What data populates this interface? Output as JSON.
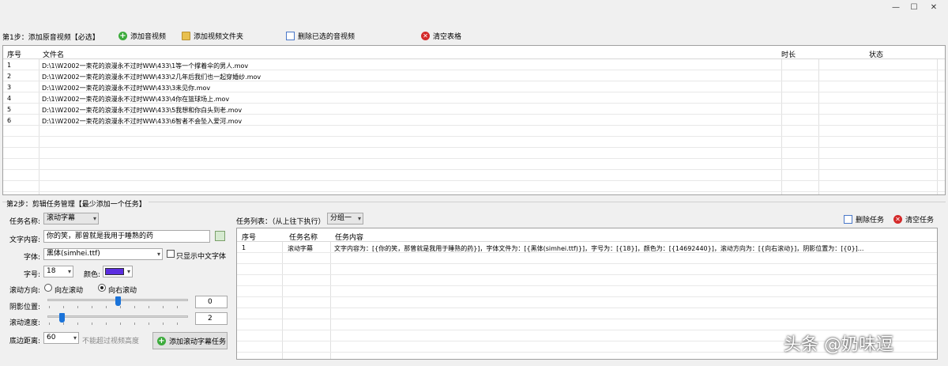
{
  "window": {
    "minimize": "—",
    "maximize": "☐",
    "close": "✕"
  },
  "step1": {
    "label": "第1步：添加原音视频【必选】",
    "add_video": "添加音视频",
    "add_folder": "添加视频文件夹",
    "delete_selected": "删除已选的音视频",
    "clear_table": "清空表格",
    "columns": [
      "序号",
      "文件名",
      "时长",
      "状态"
    ],
    "rows": [
      {
        "index": "1",
        "filename": "D:\\1\\W2002一束花的浪漫永不过时WW\\433\\1等一个撑着伞的男人.mov",
        "duration": "",
        "status": ""
      },
      {
        "index": "2",
        "filename": "D:\\1\\W2002一束花的浪漫永不过时WW\\433\\2几年后我们也一起穿婚纱.mov",
        "duration": "",
        "status": ""
      },
      {
        "index": "3",
        "filename": "D:\\1\\W2002一束花的浪漫永不过时WW\\433\\3未见你.mov",
        "duration": "",
        "status": ""
      },
      {
        "index": "4",
        "filename": "D:\\1\\W2002一束花的浪漫永不过时WW\\433\\4你在篮球场上.mov",
        "duration": "",
        "status": ""
      },
      {
        "index": "5",
        "filename": "D:\\1\\W2002一束花的浪漫永不过时WW\\433\\5我想和你白头到老.mov",
        "duration": "",
        "status": ""
      },
      {
        "index": "6",
        "filename": "D:\\1\\W2002一束花的浪漫永不过时WW\\433\\6智者不会坠入爱河.mov",
        "duration": "",
        "status": ""
      }
    ]
  },
  "step2": {
    "label": "第2步：剪辑任务管理【最少添加一个任务】",
    "task_name_label": "任务名称:",
    "task_name_value": "滚动字幕",
    "text_content_label": "文字内容:",
    "text_content_value": "你的笑，那曾就是我用于睡熟的药",
    "font_label": "字体:",
    "font_value": "黑体(simhei.ttf)",
    "only_chinese_fonts": "只显示中文字体",
    "size_label": "字号:",
    "size_value": "18",
    "color_label": "颜色:",
    "color_swatch": "#5b2de0",
    "direction_label": "滚动方向:",
    "dir_left": "向左滚动",
    "dir_right": "向右滚动",
    "shadow_label": "阴影位置:",
    "shadow_value": "0",
    "shadow_level": 0.5,
    "speed_label": "滚动速度:",
    "speed_value": "2",
    "speed_level": 0.1,
    "bottom_label": "底边距离:",
    "bottom_value": "60",
    "bottom_hint": "不能超过视频高度",
    "add_task_button": "添加滚动字幕任务"
  },
  "tasks": {
    "list_label": "任务列表：（从上往下执行）",
    "group_value": "分组一",
    "delete_task": "删除任务",
    "clear_tasks": "清空任务",
    "columns": [
      "序号",
      "任务名称",
      "任务内容"
    ],
    "rows": [
      {
        "index": "1",
        "name": "滚动字幕",
        "content": "文字内容为：[{你的笑，那曾就是我用于睡熟的药}]，字体文件为：[{黑体(simhei.ttf)}]，字号为：[{18}]，颜色为：[{14692440}]，滚动方向为：[{向右滚动}]，阴影位置为：[{0}]..."
      }
    ]
  },
  "watermark": "头条 @奶味逗"
}
